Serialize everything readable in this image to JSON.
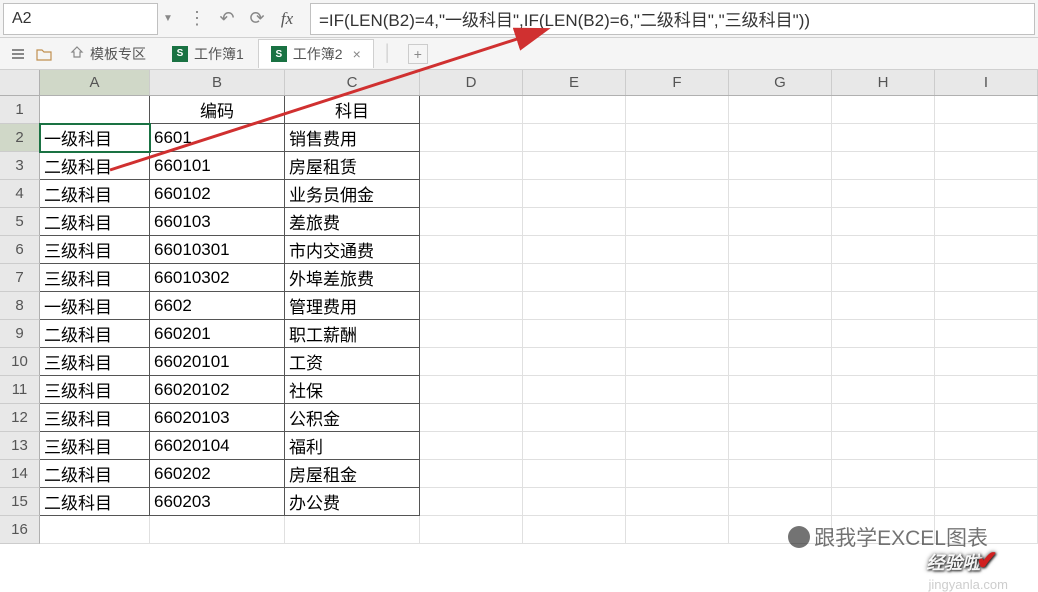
{
  "namebox": "A2",
  "formula": "=IF(LEN(B2)=4,\"一级科目\",IF(LEN(B2)=6,\"二级科目\",\"三级科目\"))",
  "tabs": {
    "template": "模板专区",
    "wb1": "工作簿1",
    "wb2": "工作簿2"
  },
  "columns": [
    "A",
    "B",
    "C",
    "D",
    "E",
    "F",
    "G",
    "H",
    "I"
  ],
  "headers": {
    "b": "编码",
    "c": "科目"
  },
  "rows": [
    {
      "n": 1,
      "a": "",
      "b_h": true,
      "c_h": true
    },
    {
      "n": 2,
      "a": "一级科目",
      "b": "6601",
      "c": "销售费用",
      "active": true
    },
    {
      "n": 3,
      "a": "二级科目",
      "b": "660101",
      "c": "房屋租赁"
    },
    {
      "n": 4,
      "a": "二级科目",
      "b": "660102",
      "c": "业务员佣金"
    },
    {
      "n": 5,
      "a": "二级科目",
      "b": "660103",
      "c": "差旅费"
    },
    {
      "n": 6,
      "a": "三级科目",
      "b": "66010301",
      "c": "市内交通费"
    },
    {
      "n": 7,
      "a": "三级科目",
      "b": "66010302",
      "c": "外埠差旅费"
    },
    {
      "n": 8,
      "a": "一级科目",
      "b": "6602",
      "c": "管理费用"
    },
    {
      "n": 9,
      "a": "二级科目",
      "b": "660201",
      "c": "职工薪酬"
    },
    {
      "n": 10,
      "a": "三级科目",
      "b": "66020101",
      "c": "工资"
    },
    {
      "n": 11,
      "a": "三级科目",
      "b": "66020102",
      "c": "社保"
    },
    {
      "n": 12,
      "a": "三级科目",
      "b": "66020103",
      "c": "公积金"
    },
    {
      "n": 13,
      "a": "三级科目",
      "b": "66020104",
      "c": "福利"
    },
    {
      "n": 14,
      "a": "二级科目",
      "b": "660202",
      "c": "房屋租金"
    },
    {
      "n": 15,
      "a": "二级科目",
      "b": "660203",
      "c": "办公费"
    },
    {
      "n": 16,
      "a": "",
      "b": "",
      "c": "",
      "noborder": true
    }
  ],
  "watermark1": "跟我学EXCEL图表",
  "watermark2": "经验啦",
  "watermark3": "jingyanla.com"
}
